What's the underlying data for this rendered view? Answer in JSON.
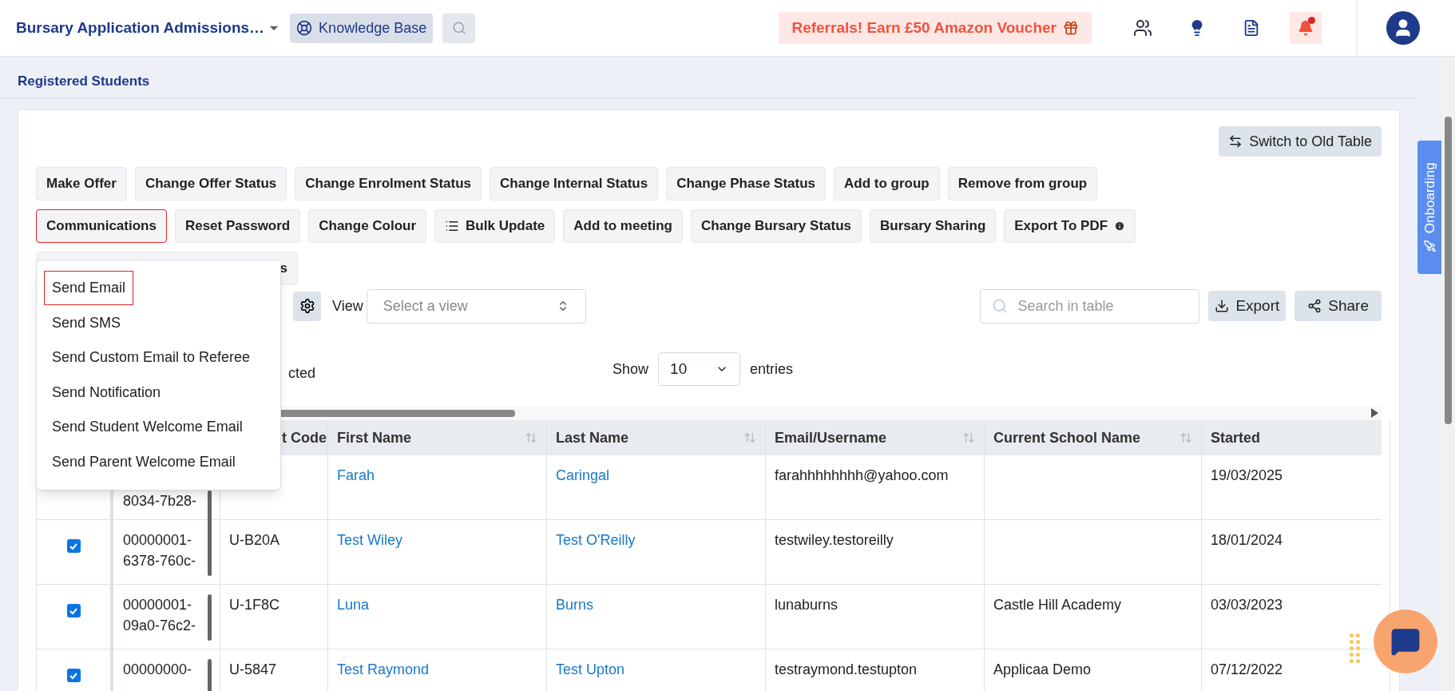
{
  "header": {
    "title": "Bursary Application Admissions…",
    "knowledge_base": "Knowledge Base",
    "referral": "Referrals! Earn £50 Amazon Voucher"
  },
  "page_title": "Registered Students",
  "switch_button": "Switch to Old Table",
  "action_rows": [
    [
      {
        "label": "Make Offer",
        "kind": "plain",
        "highlighted": false
      },
      {
        "label": "Change Offer Status",
        "kind": "plain",
        "highlighted": false
      },
      {
        "label": "Change Enrolment Status",
        "kind": "plain",
        "highlighted": false
      },
      {
        "label": "Change Internal Status",
        "kind": "plain",
        "highlighted": false
      },
      {
        "label": "Change Phase Status",
        "kind": "plain",
        "highlighted": false
      },
      {
        "label": "Add to group",
        "kind": "plain",
        "highlighted": false
      },
      {
        "label": "Remove from group",
        "kind": "plain",
        "highlighted": false
      }
    ],
    [
      {
        "label": "Communications",
        "kind": "plain",
        "highlighted": true
      },
      {
        "label": "Reset Password",
        "kind": "plain",
        "highlighted": false
      },
      {
        "label": "Change Colour",
        "kind": "plain",
        "highlighted": false
      },
      {
        "label": "Bulk Update",
        "kind": "list",
        "highlighted": false
      },
      {
        "label": "Add to meeting",
        "kind": "plain",
        "highlighted": false
      },
      {
        "label": "Change Bursary Status",
        "kind": "plain",
        "highlighted": false
      },
      {
        "label": "Bursary Sharing",
        "kind": "plain",
        "highlighted": false
      },
      {
        "label": "Export To PDF",
        "kind": "info",
        "highlighted": false
      }
    ],
    [
      {
        "label": "s",
        "kind": "plain",
        "highlighted": false
      }
    ]
  ],
  "menu": [
    {
      "label": "Send Email",
      "selected": true
    },
    {
      "label": "Send SMS",
      "selected": false
    },
    {
      "label": "Send Custom Email to Referee",
      "selected": false
    },
    {
      "label": "Send Notification",
      "selected": false
    },
    {
      "label": "Send Student Welcome Email",
      "selected": false
    },
    {
      "label": "Send Parent Welcome Email",
      "selected": false
    }
  ],
  "view_label": "View",
  "view_select": {
    "placeholder": "Select a view"
  },
  "search": {
    "placeholder": "Search in table"
  },
  "export": "Export",
  "share": "Share",
  "selected_text": "cted",
  "show_label": "Show",
  "entries_value": "10",
  "entries_label": "entries",
  "table": {
    "columns": [
      {
        "label": "t Code",
        "sortable": false
      },
      {
        "label": "First Name",
        "sortable": true
      },
      {
        "label": "Last Name",
        "sortable": true
      },
      {
        "label": "Email/Username",
        "sortable": true
      },
      {
        "label": "Current School Name",
        "sortable": true
      },
      {
        "label": "Started",
        "sortable": false
      }
    ],
    "rows": [
      {
        "id_lines": [
          "8034-7b28-"
        ],
        "code": "",
        "first": "Farah",
        "last": "Caringal",
        "email": "farahhhhhhhh@yahoo.com",
        "school": "",
        "started": "19/03/2025"
      },
      {
        "checked": true,
        "id_lines": [
          "00000001-",
          "6378-760c-"
        ],
        "code": "U-B20A",
        "first": "Test Wiley",
        "last": "Test O'Reilly",
        "email": "testwiley.testoreilly",
        "school": "",
        "started": "18/01/2024"
      },
      {
        "checked": true,
        "id_lines": [
          "00000001-",
          "09a0-76c2-"
        ],
        "code": "U-1F8C",
        "first": "Luna",
        "last": "Burns",
        "email": "lunaburns",
        "school": "Castle Hill Academy",
        "started": "03/03/2023"
      },
      {
        "checked": true,
        "id_lines": [
          "00000000-"
        ],
        "code": "U-5847",
        "first": "Test Raymond",
        "last": "Test Upton",
        "email": "testraymond.testupton",
        "school": "Applicaa Demo",
        "started": "07/12/2022"
      }
    ]
  },
  "onboarding": "Onboarding"
}
